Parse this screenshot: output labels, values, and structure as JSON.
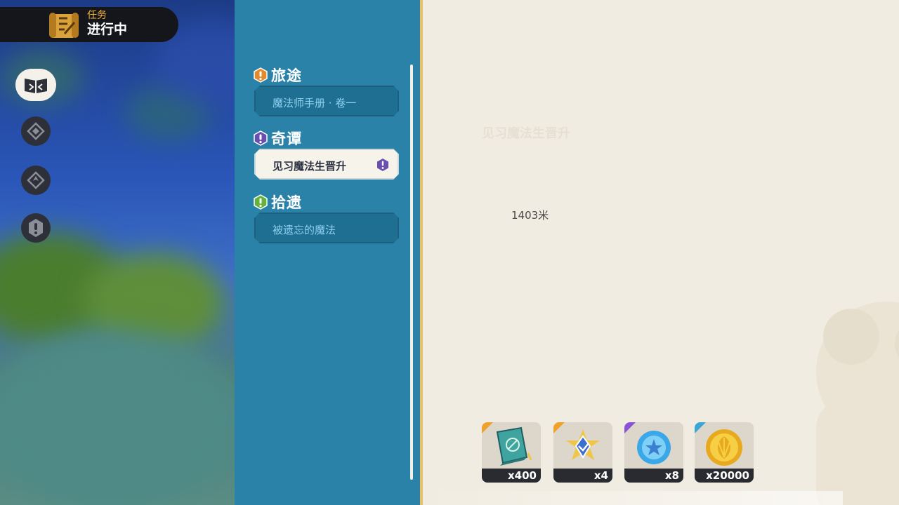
{
  "header": {
    "sub": "任务",
    "title": "进行中"
  },
  "nav": [
    {
      "icon": "open-book-icon",
      "active": true
    },
    {
      "icon": "compass-diamond-icon",
      "active": false
    },
    {
      "icon": "compass-arrow-icon",
      "active": false
    },
    {
      "icon": "exclamation-icon",
      "active": false
    }
  ],
  "categories": [
    {
      "label": "旅途",
      "color": "#e58a2a",
      "quests": [
        {
          "label": "魔法师手册 · 卷一",
          "selected": false
        }
      ]
    },
    {
      "label": "奇谭",
      "color": "#6b4fb0",
      "quests": [
        {
          "label": "见习魔法生晋升",
          "selected": true
        }
      ]
    },
    {
      "label": "拾遗",
      "color": "#63b33c",
      "quests": [
        {
          "label": "被遗忘的魔法",
          "selected": false
        }
      ]
    }
  ],
  "detail": {
    "title": "见习魔法生晋升",
    "distance": "1403米"
  },
  "rewards": [
    {
      "icon": "spellbook-icon",
      "qty": "x400",
      "rarity_color": "#f0a12a"
    },
    {
      "icon": "star-crystal-icon",
      "qty": "x4",
      "rarity_color": "#f0a12a"
    },
    {
      "icon": "blue-gem-icon",
      "qty": "x8",
      "rarity_color": "#8a52d8"
    },
    {
      "icon": "gold-coin-icon",
      "qty": "x20000",
      "rarity_color": "#3aa6d6"
    }
  ]
}
